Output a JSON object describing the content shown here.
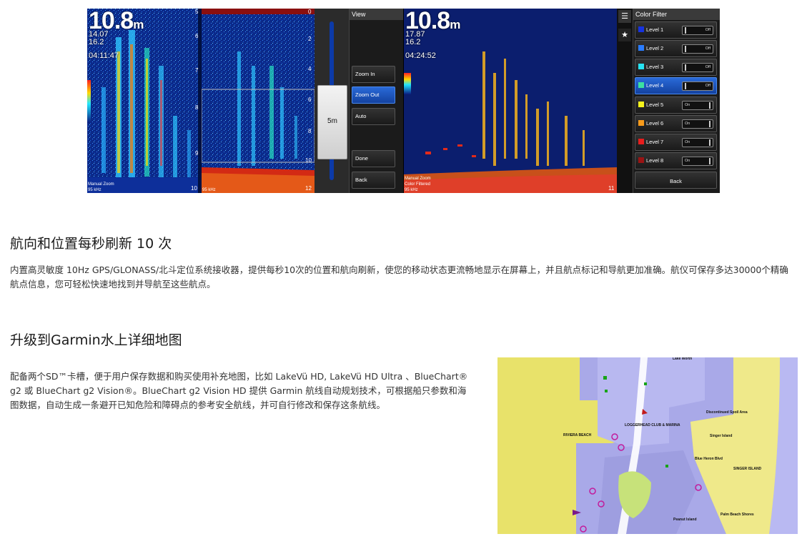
{
  "sonar": {
    "left": {
      "depth": "10.8",
      "unit": "m",
      "readings": [
        "14.07",
        "16.2",
        "04:11:47"
      ],
      "footer": [
        "Manual Zoom",
        "95 kHz"
      ],
      "scale": [
        "5",
        "6",
        "7",
        "8",
        "9",
        "10"
      ]
    },
    "middle": {
      "scale": [
        "0",
        "2",
        "4",
        "6",
        "8",
        "10",
        "12"
      ],
      "footer": "95 kHz",
      "zoom_label": "5m"
    },
    "view_menu": {
      "title": "View",
      "zoom_in": "Zoom In",
      "zoom_out": "Zoom Out",
      "auto": "Auto",
      "done": "Done",
      "back": "Back"
    },
    "right": {
      "depth": "10.8",
      "unit": "m",
      "readings": [
        "17.87",
        "16.2",
        "04:24:52"
      ],
      "footer": [
        "Manual Zoom",
        "Color Filtered",
        "95 kHz"
      ],
      "bottom_scale": "11"
    },
    "color_filter": {
      "title": "Color Filter",
      "levels": [
        {
          "label": "Level 1",
          "state": "Off",
          "color": "#1633e0"
        },
        {
          "label": "Level 2",
          "state": "Off",
          "color": "#2a7cff"
        },
        {
          "label": "Level 3",
          "state": "Off",
          "color": "#27e3f2"
        },
        {
          "label": "Level 4",
          "state": "Off",
          "color": "#3ce0a0"
        },
        {
          "label": "Level 5",
          "state": "On",
          "color": "#f5f31c"
        },
        {
          "label": "Level 6",
          "state": "On",
          "color": "#f79a1a"
        },
        {
          "label": "Level 7",
          "state": "On",
          "color": "#e81d1d"
        },
        {
          "label": "Level 8",
          "state": "On",
          "color": "#9a1414"
        }
      ],
      "back": "Back"
    }
  },
  "section1": {
    "heading": "航向和位置每秒刷新 10 次",
    "body": "内置高灵敏度 10Hz GPS/GLONASS/北斗定位系统接收器，提供每秒10次的位置和航向刷新，使您的移动状态更流畅地显示在屏幕上，并且航点标记和导航更加准确。航仪可保存多达30000个精确航点信息，您可轻松快速地找到并导航至这些航点。"
  },
  "section2": {
    "heading": "升级到Garmin水上详细地图",
    "body": "配备两个SD™卡槽，便于用户保存数据和购买使用补充地图，比如 LakeVü HD, LakeVü HD Ultra 、BlueChart® g2 或 BlueChart g2 Vision®。BlueChart g2 Vision HD 提供 Garmin 航线自动规划技术，可根据船只参数和海图数据，自动生成一条避开已知危险和障碍点的参考安全航线，并可自行修改和保存这条航线。"
  },
  "map": {
    "labels": [
      "RIVIERA BEACH",
      "LOGGERHEAD CLUB & MARINA",
      "Singer Island",
      "SINGER ISLAND",
      "Palm Beach Shores",
      "Peanut Island",
      "Discontinued Spoil Area",
      "Blue Heron Blvd",
      "Lake Worth"
    ]
  }
}
